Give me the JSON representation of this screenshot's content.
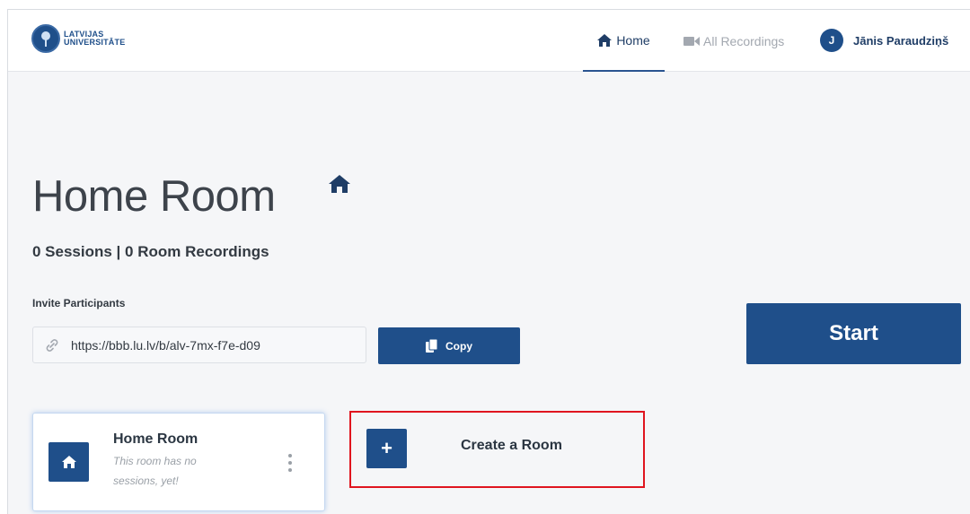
{
  "brand": {
    "logo_line1": "LATVIJAS",
    "logo_line2": "UNIVERSITĀTE"
  },
  "nav": {
    "home_label": "Home",
    "recordings_label": "All Recordings",
    "avatar_initial": "J",
    "user_name": "Jānis Paraudziņš"
  },
  "room": {
    "title": "Home Room",
    "stats": "0 Sessions | 0 Room Recordings",
    "invite_label": "Invite Participants",
    "invite_url": "https://bbb.lu.lv/b/alv-7mx-f7e-d09",
    "copy_label": "Copy",
    "start_label": "Start"
  },
  "cards": {
    "home_room_name": "Home Room",
    "home_room_status": "This room has no sessions, yet!",
    "create_plus": "+",
    "create_label": "Create a Room"
  },
  "colors": {
    "primary": "#1f4f8a",
    "highlight": "#e0151f",
    "background": "#f5f6f8"
  }
}
